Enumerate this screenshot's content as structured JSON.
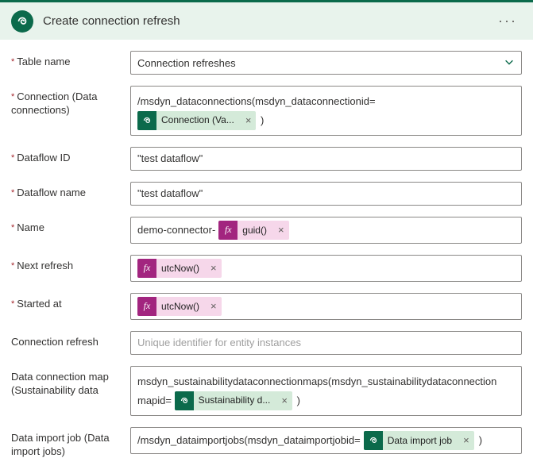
{
  "header": {
    "title": "Create connection refresh",
    "menu_icon": "···"
  },
  "fields": {
    "table_name": {
      "label": "Table name",
      "value": "Connection refreshes"
    },
    "connection": {
      "label": "Connection (Data connections)",
      "prefix": "/msdyn_dataconnections(msdyn_dataconnectionid=",
      "token": "Connection (Va...",
      "suffix": ")"
    },
    "dataflow_id": {
      "label": "Dataflow ID",
      "value": "\"test dataflow\""
    },
    "dataflow_name": {
      "label": "Dataflow name",
      "value": "\"test dataflow\""
    },
    "name": {
      "label": "Name",
      "prefix": "demo-connector-",
      "token": "guid()"
    },
    "next_refresh": {
      "label": "Next refresh",
      "token": "utcNow()"
    },
    "started_at": {
      "label": "Started at",
      "token": "utcNow()"
    },
    "connection_refresh": {
      "label": "Connection refresh",
      "placeholder": "Unique identifier for entity instances"
    },
    "data_connection_map": {
      "label": "Data connection map (Sustainability data",
      "line1": "msdyn_sustainabilitydataconnectionmaps(msdyn_sustainabilitydataconnection",
      "line2_prefix": "mapid=",
      "token": "Sustainability d...",
      "suffix": ")"
    },
    "data_import_job": {
      "label": "Data import job (Data import jobs)",
      "prefix": "/msdyn_dataimportjobs(msdyn_dataimportjobid=",
      "token": "Data import job",
      "suffix": ")"
    }
  },
  "fx_badge": "fx",
  "remove_x": "×"
}
